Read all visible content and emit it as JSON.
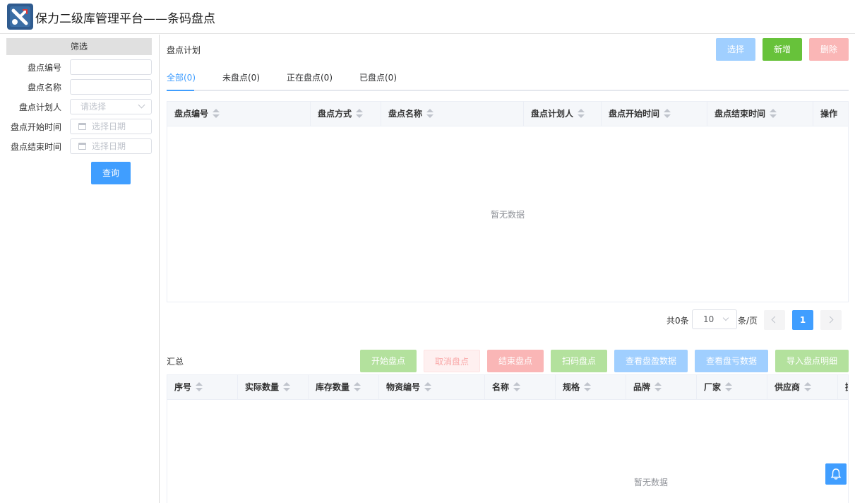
{
  "header": {
    "title": "保力二级库管理平台——条码盘点"
  },
  "filter": {
    "title": "筛选",
    "fields": [
      {
        "label": "盘点编号",
        "value": "",
        "placeholder": ""
      },
      {
        "label": "盘点名称",
        "value": "",
        "placeholder": ""
      },
      {
        "label": "盘点计划人",
        "placeholder": "请选择"
      },
      {
        "label": "盘点开始时间",
        "placeholder": "选择日期"
      },
      {
        "label": "盘点结束时间",
        "placeholder": "选择日期"
      }
    ],
    "query_label": "查询"
  },
  "plan": {
    "title": "盘点计划",
    "buttons": {
      "select": "选择",
      "add": "新增",
      "delete": "删除"
    },
    "tabs": [
      "全部(0)",
      "未盘点(0)",
      "正在盘点(0)",
      "已盘点(0)"
    ],
    "active_tab": "全部(0)",
    "columns": [
      "盘点编号",
      "盘点方式",
      "盘点名称",
      "盘点计划人",
      "盘点开始时间",
      "盘点结束时间",
      "操作"
    ],
    "empty_text": "暂无数据",
    "pagination": {
      "total_text": "共0条",
      "page_size": "10",
      "page_size_unit": "条/页",
      "current_page": "1"
    }
  },
  "summary": {
    "title": "汇总",
    "buttons": [
      "开始盘点",
      "取消盘点",
      "结束盘点",
      "扫码盘点",
      "查看盘盈数据",
      "查看盘亏数据",
      "导入盘点明细"
    ],
    "columns": [
      "序号",
      "实际数量",
      "库存数量",
      "物资编号",
      "名称",
      "规格",
      "品牌",
      "厂家",
      "供应商",
      "操"
    ],
    "empty_text": "暂无数据"
  },
  "colors": {
    "primary": "#409eff",
    "success": "#67c23a",
    "danger_light": "#fab6b6"
  },
  "icons": {
    "logo": "wrench-logo-icon",
    "bell": "bell-icon"
  }
}
